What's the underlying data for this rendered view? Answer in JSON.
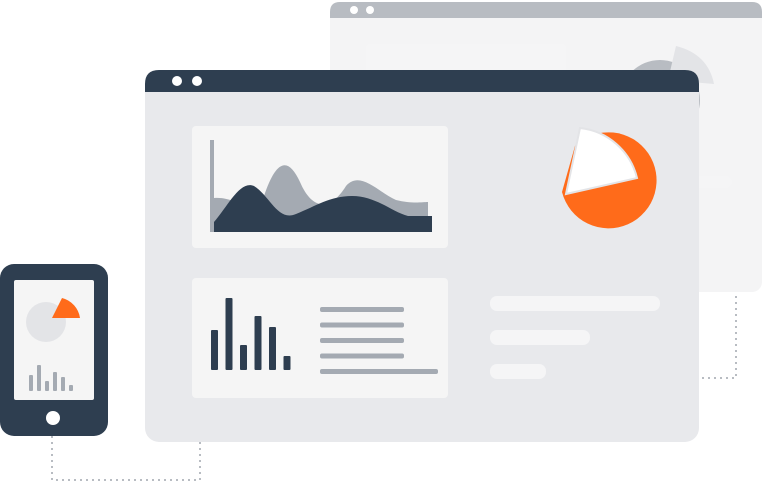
{
  "colors": {
    "dark": "#2e3e50",
    "accent": "#ff6b1a",
    "window_body": "#e8e9ec",
    "panel": "#f5f5f5",
    "back_window_body": "#f4f4f5",
    "back_window_bar": "#b8bcc2",
    "area_back": "#a4aab2",
    "text_line": "#a4aab2",
    "placeholder_bar": "#f5f5f6",
    "connector": "#b8bcc2",
    "white": "#ffffff",
    "pie_rest_light": "#e3e4e7",
    "pie_rest_grey": "#c4c8cd"
  },
  "icons": {
    "front_window_dots": "window-control-dots-icon",
    "back_window_dots": "window-control-dots-icon",
    "phone_home_button": "home-button-icon"
  },
  "illustration": {
    "front_bar_values": [
      0.55,
      1.0,
      0.35,
      0.75,
      0.6,
      0.2
    ],
    "phone_bar_values": [
      0.5,
      0.8,
      0.3,
      0.6,
      0.45,
      0.2
    ],
    "text_line_count": 5,
    "placeholder_bar_count": 3
  }
}
